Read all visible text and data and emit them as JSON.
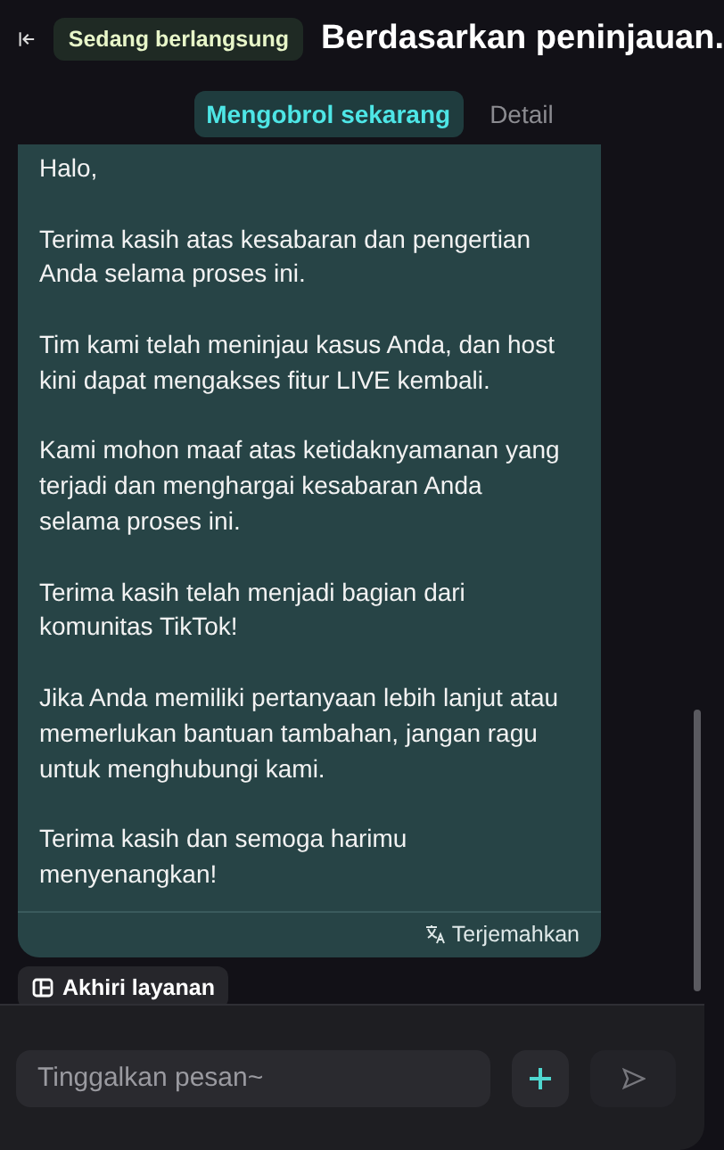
{
  "header": {
    "status": "Sedang berlangsung",
    "title": "Berdasarkan peninjauan."
  },
  "tabs": [
    {
      "label": "Mengobrol sekarang",
      "selected": true
    },
    {
      "label": "Detail",
      "selected": false
    }
  ],
  "message": {
    "paragraphs": [
      "Halo,",
      "Terima kasih atas kesabaran dan pengertian Anda selama proses ini.",
      "Tim kami telah meninjau kasus Anda, dan host kini dapat mengakses fitur LIVE kembali.",
      "Kami mohon maaf atas ketidaknyamanan yang terjadi dan menghargai kesabaran Anda selama proses ini.",
      "Terima kasih telah menjadi bagian dari komunitas TikTok!",
      "Jika Anda memiliki pertanyaan lebih lanjut atau memerlukan bantuan tambahan, jangan ragu untuk menghubungi kami.",
      "Terima kasih dan semoga harimu menyenangkan!"
    ],
    "translate": "Terjemahkan"
  },
  "end_service": "Akhiri layanan",
  "composer": {
    "placeholder": "Tinggalkan pesan~"
  }
}
